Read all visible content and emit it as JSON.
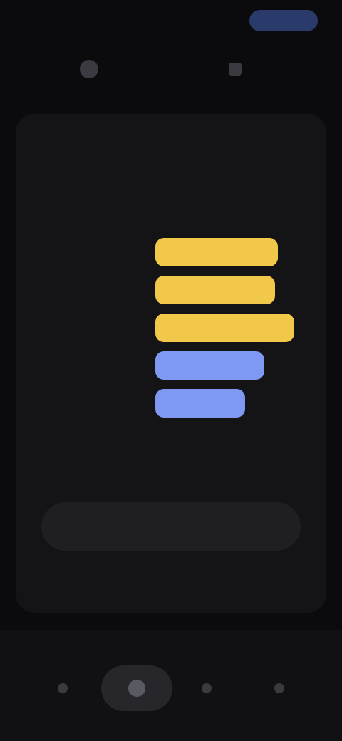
{
  "status_bar": {
    "time": "",
    "pill_label": ""
  },
  "nav": {
    "back_label": "",
    "action_label": ""
  },
  "card": {
    "title": "",
    "subtitle": "",
    "bars": [
      {
        "label": "",
        "fill_fraction": 0.82,
        "color": "#f2c84b"
      },
      {
        "label": "",
        "fill_fraction": 0.8,
        "color": "#f2c84b"
      },
      {
        "label": "",
        "fill_fraction": 0.93,
        "color": "#f2c84b"
      },
      {
        "label": "",
        "fill_fraction": 0.73,
        "color": "#7f98f2"
      },
      {
        "label": "",
        "fill_fraction": 0.6,
        "color": "#7f98f2"
      }
    ],
    "primary_button_label": "",
    "secondary_link_label": ""
  },
  "bottom_nav": {
    "items": [
      {
        "icon": "circle-icon"
      },
      {
        "icon": "home-icon"
      },
      {
        "icon": "circle-icon"
      },
      {
        "icon": "circle-icon"
      }
    ]
  }
}
